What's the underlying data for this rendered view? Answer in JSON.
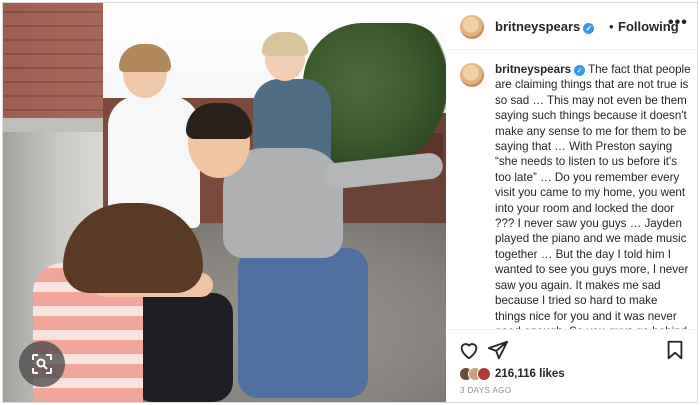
{
  "post": {
    "username": "britneyspears",
    "follow_status": "Following",
    "separator": "•",
    "more_label": "•••",
    "caption": "The fact that people are claiming things that are not true is so sad … This may not even be them saying such things because it doesn't make any sense to me for them to be saying that … With Preston saying “she needs to listen to us before it's too late” … Do you remember every visit you came to my home, you went into your room and locked the door ??? I never saw you guys … Jayden played the piano and we made music together … But the day I told him I wanted to see you guys more, I never saw you again. It makes me sad because I tried so hard to make things nice for you and it was never good enough. So you guys go behind my back and talk about me … it breaks my heart",
    "likes": "216,116 likes",
    "posted_ago": "3 DAYS AGO"
  },
  "icons": {
    "verified": "verified-badge-icon",
    "lens": "lens-search-icon",
    "like": "heart-icon",
    "share": "paper-plane-icon",
    "save": "bookmark-icon"
  },
  "colors": {
    "verified": "#3897f0",
    "text": "#262626",
    "muted": "#8e8e8e"
  }
}
